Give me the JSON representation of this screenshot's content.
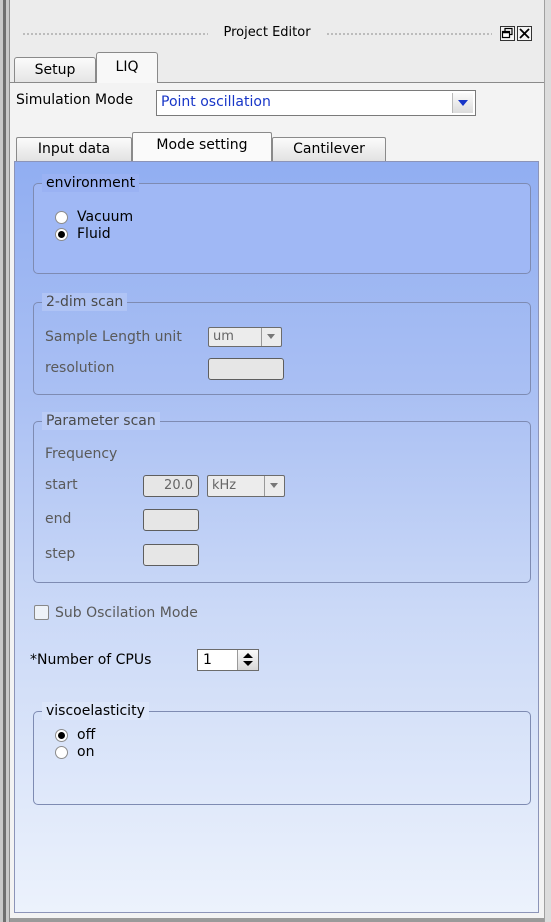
{
  "window": {
    "title": "Project Editor"
  },
  "top_tabs": [
    "Setup",
    "LIQ"
  ],
  "simulation_mode": {
    "label": "Simulation Mode",
    "value": "Point oscillation"
  },
  "inner_tabs": [
    "Input data",
    "Mode setting",
    "Cantilever"
  ],
  "environment": {
    "title": "environment",
    "options": [
      "Vacuum",
      "Fluid"
    ],
    "selected": "Fluid"
  },
  "scan_2dim": {
    "title": "2-dim scan",
    "sample_length_label": "Sample Length unit",
    "sample_length_unit": "um",
    "resolution_label": "resolution"
  },
  "parameter_scan": {
    "title": "Parameter scan",
    "frequency_label": "Frequency",
    "start_label": "start",
    "start_value": "20.0",
    "start_unit": "kHz",
    "end_label": "end",
    "step_label": "step"
  },
  "sub_oscillation": {
    "label": "Sub Oscilation Mode",
    "checked": false
  },
  "cpus": {
    "label": "*Number of CPUs",
    "value": "1"
  },
  "viscoelasticity": {
    "title": "viscoelasticity",
    "options": [
      "off",
      "on"
    ],
    "selected": "off"
  },
  "colors": {
    "accent_blue": "#1836c8",
    "panel_blue": "#91aef2"
  }
}
